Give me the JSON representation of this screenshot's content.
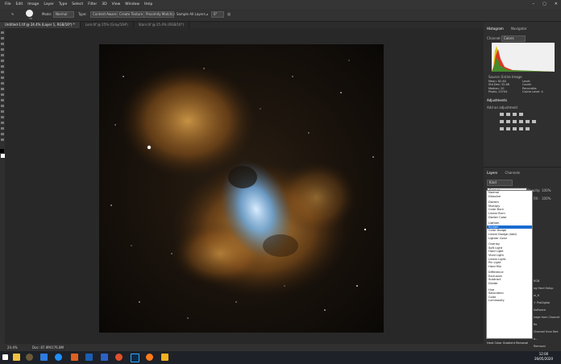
{
  "menubar": {
    "items": [
      "File",
      "Edit",
      "Image",
      "Layer",
      "Type",
      "Select",
      "Filter",
      "3D",
      "View",
      "Window",
      "Help"
    ]
  },
  "optionsbar": {
    "brush_size": "70",
    "mode_label": "Mode:",
    "mode_value": "Normal",
    "types_label": "Type:",
    "type_buttons": [
      "Content-Aware",
      "Create Texture",
      "Proximity Match"
    ],
    "sample_all": "Sample All Layers",
    "angle": "0°"
  },
  "tabs": [
    "Untitled-1.tif @ 24.4% (Layer 1, RGB/16*) *",
    "Lum.tif @ 25% (Gray/16#)",
    "Stars.tif @ 25.4% (RGB/16*)"
  ],
  "status": {
    "zoom": "24.4%",
    "doc": "Doc: 87.9M/176.8M"
  },
  "histogram": {
    "tab1": "Histogram",
    "tab2": "Navigator",
    "channel_label": "Channel:",
    "channel_value": "Colors",
    "source_label": "Source:",
    "source_value": "Entire Image",
    "stats_left": [
      "Mean: 62.80",
      "Std Dev: 32.88",
      "Median: 20",
      "Pixels: 23704"
    ],
    "stats_right": [
      "Level:",
      "Count:",
      "Percentile:",
      "Cache Level: 4"
    ]
  },
  "adjustments": {
    "title": "Adjustments",
    "hint": "Add an adjustment"
  },
  "layers": {
    "tab1": "Layers",
    "tab2": "Channels",
    "kind": "Kind",
    "blend_value": "Screen",
    "opacity_label": "Opacity:",
    "opacity_value": "100%",
    "fill_label": "Fill:",
    "fill_value": "100%"
  },
  "blend_modes": [
    "Normal",
    "Dissolve",
    "",
    "Darken",
    "Multiply",
    "Color Burn",
    "Linear Burn",
    "Darker Color",
    "",
    "Lighten",
    "Screen",
    "Color Dodge",
    "Linear Dodge (Add)",
    "Lighter Color",
    "",
    "Overlay",
    "Soft Light",
    "Hard Light",
    "Vivid Light",
    "Linear Light",
    "Pin Light",
    "Hard Mix",
    "",
    "Difference",
    "Exclusion",
    "Subtract",
    "Divide",
    "",
    "Hue",
    "Saturation",
    "Color",
    "Luminosity"
  ],
  "history": [
    "RGB",
    "ng Hard Setup",
    "ol_6",
    "+ ProDigital Software",
    "nage from Channel Re",
    "Channel from Red a...",
    "Removal",
    "Hard Color Gradient Removal"
  ],
  "taskbar": {
    "time": "12:00",
    "date": "26/05/2020"
  },
  "colors": {
    "accent": "#31a8ff",
    "highlight": "#1a6cd0"
  }
}
